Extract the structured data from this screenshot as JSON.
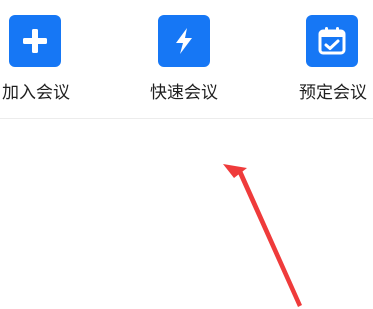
{
  "quick_actions": [
    {
      "id": "join",
      "label": "加入会议",
      "icon": "plus-icon"
    },
    {
      "id": "quick",
      "label": "快速会议",
      "icon": "lightning-bolt-icon"
    },
    {
      "id": "schedule",
      "label": "预定会议",
      "icon": "calendar-check-icon"
    }
  ],
  "colors": {
    "tile_blue": "#1677f5",
    "annotation_arrow": "#ef3b3b",
    "label_text": "#1f1f1f"
  }
}
